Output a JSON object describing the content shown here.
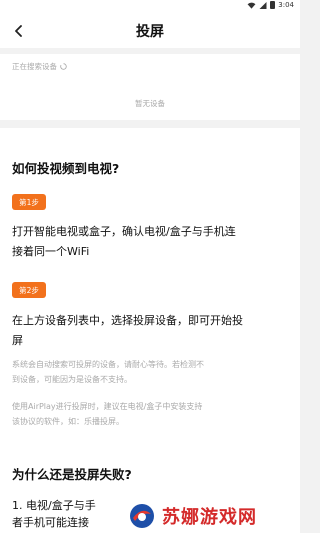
{
  "status_bar": {
    "time": "3:04"
  },
  "header": {
    "title": "投屏"
  },
  "devices": {
    "searching_label": "正在搜索设备",
    "empty_label": "暂无设备"
  },
  "guide": {
    "title": "如何投视频到电视?",
    "step1_badge": "第1步",
    "step1_line1": "打开智能电视或盒子，确认电视/盒子与手机连",
    "step1_line2": "接着同一个WiFi",
    "step2_badge": "第2步",
    "step2_line1": "在上方设备列表中，选择投屏设备，即可开始投",
    "step2_line2": "屏",
    "note1_line1": "系统会自动搜索可投屏的设备，请耐心等待。若检测不",
    "note1_line2": "到设备，可能因为是设备不支持。",
    "note2_line1": "使用AirPlay进行投屏时，建议在电视/盒子中安装支持",
    "note2_line2": "该协议的软件，如：乐播投屏。"
  },
  "faq": {
    "title": "为什么还是投屏失败?",
    "item1_line1": "1. 电视/盒子与手",
    "item1_line2": "者手机可能连接"
  },
  "watermark": {
    "text": "苏娜游戏网"
  }
}
